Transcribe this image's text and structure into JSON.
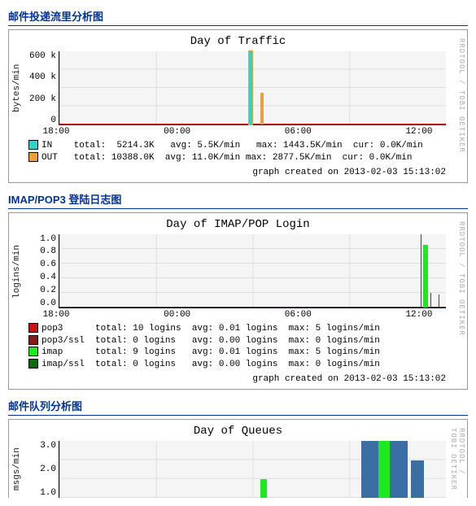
{
  "sections": {
    "traffic": {
      "heading": "邮件投递流里分析图",
      "title": "Day of Traffic",
      "ylabel": "bytes/min",
      "side": "RRDTOOL / TOBI OETIKER",
      "yticks": [
        "600 k",
        "400 k",
        "200 k",
        "0"
      ],
      "xticks": [
        "18:00",
        "00:00",
        "06:00",
        "12:00"
      ],
      "legend": {
        "in": {
          "color": "#2BD6C6",
          "label": "IN",
          "total": "5214.3K",
          "avg": "5.5K/min",
          "max": "1443.5K/min",
          "cur": "0.0K/min"
        },
        "out": {
          "color": "#E8A23D",
          "label": "OUT",
          "total": "10388.0K",
          "avg": "11.0K/min",
          "max": "2877.5K/min",
          "cur": "0.0K/min"
        }
      },
      "footer": "graph created on 2013-02-03 15:13:02"
    },
    "login": {
      "heading": "IMAP/POP3 登陆日志图",
      "title": "Day of IMAP/POP Login",
      "ylabel": "logins/min",
      "side": "RRDTOOL / TOBI OETIKER",
      "yticks": [
        "1.0",
        "0.8",
        "0.6",
        "0.4",
        "0.2",
        "0.0"
      ],
      "xticks": [
        "18:00",
        "00:00",
        "06:00",
        "12:00"
      ],
      "legend": {
        "pop3": {
          "color": "#C81414",
          "label": "pop3",
          "total": "10 logins",
          "avg": "0.01 logins",
          "max": "5 logins/min"
        },
        "pop3ssl": {
          "color": "#8B1A1A",
          "label": "pop3/ssl",
          "total": "0 logins",
          "avg": "0.00 logins",
          "max": "0 logins/min"
        },
        "imap": {
          "color": "#1EE81E",
          "label": "imap",
          "total": "9 logins",
          "avg": "0.01 logins",
          "max": "5 logins/min"
        },
        "imapssl": {
          "color": "#0A6A0A",
          "label": "imap/ssl",
          "total": "0 logins",
          "avg": "0.00 logins",
          "max": "0 logins/min"
        }
      },
      "footer": "graph created on 2013-02-03 15:13:02"
    },
    "queues": {
      "heading": "邮件队列分析图",
      "title": "Day of Queues",
      "ylabel": "msgs/min",
      "side": "RRDTOOL / TOBI OETIKER",
      "yticks": [
        "3.0",
        "2.0",
        "1.0"
      ],
      "xticks": []
    }
  },
  "chart_data": [
    {
      "type": "line",
      "title": "Day of Traffic",
      "xlabel": "",
      "ylabel": "bytes/min",
      "x_range_hours": [
        "15:00_prev_day",
        "15:00"
      ],
      "ylim": [
        0,
        700000
      ],
      "series": [
        {
          "name": "IN",
          "color": "#2BD6C6",
          "peak_time": "~03:00",
          "peak_value": 700000
        },
        {
          "name": "OUT",
          "color": "#E8A23D",
          "peak_time": "~03:30",
          "peak_value": 300000
        }
      ],
      "stats": {
        "IN": {
          "total_K": 5214.3,
          "avg_K_per_min": 5.5,
          "max_K_per_min": 1443.5,
          "cur_K_per_min": 0.0
        },
        "OUT": {
          "total_K": 10388.0,
          "avg_K_per_min": 11.0,
          "max_K_per_min": 2877.5,
          "cur_K_per_min": 0.0
        }
      }
    },
    {
      "type": "line",
      "title": "Day of IMAP/POP Login",
      "xlabel": "",
      "ylabel": "logins/min",
      "ylim": [
        0,
        1.0
      ],
      "series": [
        {
          "name": "pop3",
          "color": "#C81414",
          "peak_time": "~14:30",
          "peak_value": 1.0
        },
        {
          "name": "pop3/ssl",
          "color": "#8B1A1A",
          "flat": 0
        },
        {
          "name": "imap",
          "color": "#1EE81E",
          "peak_time": "~14:30",
          "peak_value": 0.9
        },
        {
          "name": "imap/ssl",
          "color": "#0A6A0A",
          "flat": 0
        }
      ],
      "stats": {
        "pop3": {
          "total_logins": 10,
          "avg": 0.01,
          "max_per_min": 5
        },
        "pop3/ssl": {
          "total_logins": 0,
          "avg": 0.0,
          "max_per_min": 0
        },
        "imap": {
          "total_logins": 9,
          "avg": 0.01,
          "max_per_min": 5
        },
        "imap/ssl": {
          "total_logins": 0,
          "avg": 0.0,
          "max_per_min": 0
        }
      }
    },
    {
      "type": "bar",
      "title": "Day of Queues",
      "xlabel": "",
      "ylabel": "msgs/min",
      "ylim": [
        0,
        3.0
      ],
      "visible_bars": [
        {
          "approx_time": "03:30",
          "value": 1.0,
          "color": "#1EE81E"
        },
        {
          "approx_time": "11:00",
          "value": 3.0,
          "color": "#3B6FA3"
        },
        {
          "approx_time": "11:30",
          "value": 3.0,
          "color": "#1EE81E"
        },
        {
          "approx_time": "12:00",
          "value": 3.0,
          "color": "#3B6FA3"
        },
        {
          "approx_time": "13:00",
          "value": 2.0,
          "color": "#3B6FA3"
        }
      ]
    }
  ]
}
